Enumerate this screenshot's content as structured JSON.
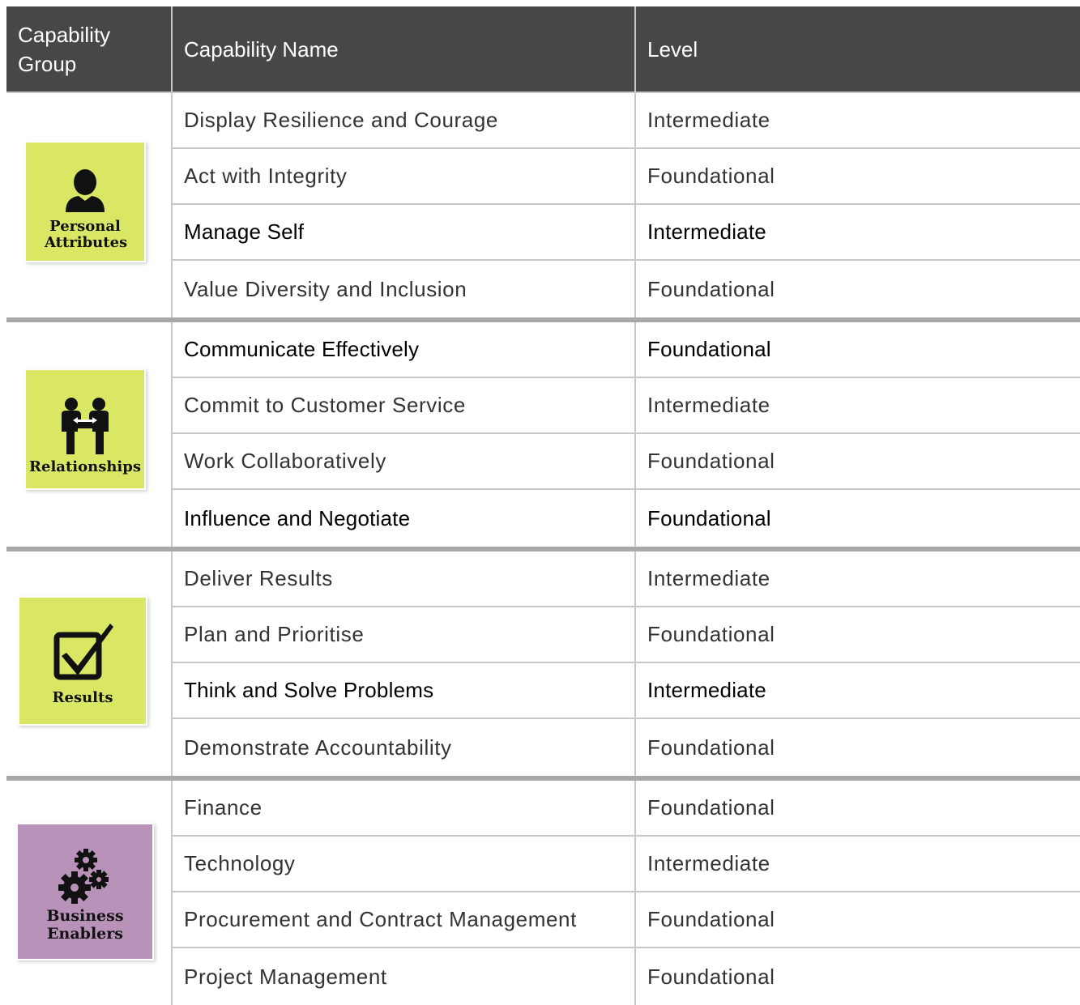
{
  "header": {
    "group": "Capability Group",
    "name": "Capability Name",
    "level": "Level"
  },
  "groups": [
    {
      "label": "Personal Attributes",
      "icon": "person-icon",
      "color": "#d9e765",
      "rows": [
        {
          "name": "Display Resilience and Courage",
          "level": "Intermediate",
          "bold": false
        },
        {
          "name": "Act with Integrity",
          "level": "Foundational",
          "bold": false
        },
        {
          "name": "Manage Self",
          "level": "Intermediate",
          "bold": true
        },
        {
          "name": "Value Diversity and Inclusion",
          "level": "Foundational",
          "bold": false
        }
      ]
    },
    {
      "label": "Relationships",
      "icon": "people-icon",
      "color": "#d9e765",
      "rows": [
        {
          "name": "Communicate Effectively",
          "level": "Foundational",
          "bold": true
        },
        {
          "name": "Commit to Customer Service",
          "level": "Intermediate",
          "bold": false
        },
        {
          "name": "Work Collaboratively",
          "level": "Foundational",
          "bold": false
        },
        {
          "name": "Influence and Negotiate",
          "level": "Foundational",
          "bold": true
        }
      ]
    },
    {
      "label": "Results",
      "icon": "checkbox-icon",
      "color": "#d9e765",
      "rows": [
        {
          "name": "Deliver Results",
          "level": "Intermediate",
          "bold": false
        },
        {
          "name": "Plan and Prioritise",
          "level": "Foundational",
          "bold": false
        },
        {
          "name": "Think and Solve Problems",
          "level": "Intermediate",
          "bold": true
        },
        {
          "name": "Demonstrate Accountability",
          "level": "Foundational",
          "bold": false
        }
      ]
    },
    {
      "label": "Business Enablers",
      "icon": "gears-icon",
      "color": "#b892b8",
      "rows": [
        {
          "name": "Finance",
          "level": "Foundational",
          "bold": false
        },
        {
          "name": "Technology",
          "level": "Intermediate",
          "bold": false
        },
        {
          "name": "Procurement and Contract Management",
          "level": "Foundational",
          "bold": false
        },
        {
          "name": "Project Management",
          "level": "Foundational",
          "bold": false
        }
      ]
    }
  ]
}
